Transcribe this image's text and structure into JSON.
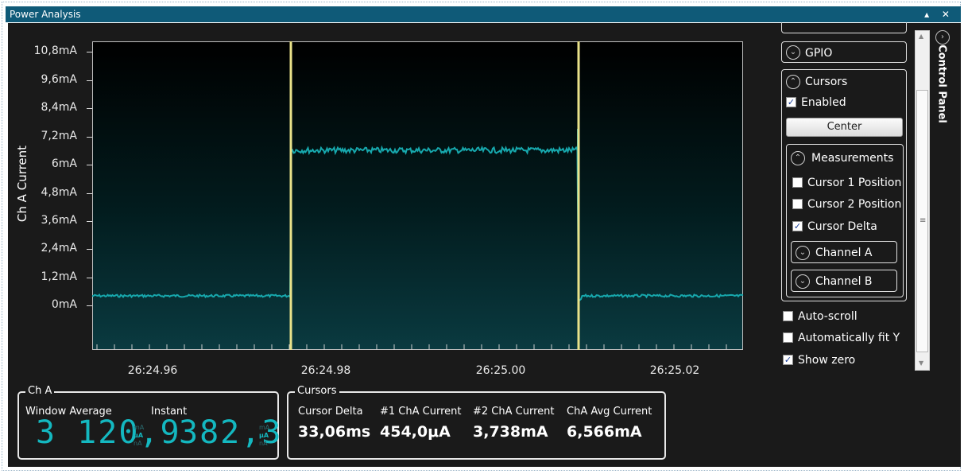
{
  "window": {
    "title": "Power Analysis",
    "controls": "▴ ✕"
  },
  "chart": {
    "y_axis_title": "Ch A Current",
    "y_ticks": [
      "10,8mA",
      "9,6mA",
      "8,4mA",
      "7,2mA",
      "6mA",
      "4,8mA",
      "3,6mA",
      "2,4mA",
      "1,2mA",
      "0mA"
    ],
    "x_ticks": [
      "26:24.96",
      "26:24.98",
      "26:25.00",
      "26:25.02"
    ],
    "trace_color": "#17a8ad",
    "cursor_color": "#e9e28a"
  },
  "chart_data": {
    "type": "line",
    "title": "",
    "xlabel": "",
    "ylabel": "Ch A Current",
    "x_unit": "s (mm:ss.ss)",
    "ylim_mA": [
      -0.6,
      11.6
    ],
    "series": [
      {
        "values_mA": [
          [
            0.0,
            0.45
          ],
          [
            0.3,
            0.45
          ],
          [
            0.301,
            6.5
          ],
          [
            0.75,
            6.6
          ],
          [
            0.751,
            0.2
          ],
          [
            0.76,
            0.45
          ],
          [
            1.0,
            0.45
          ]
        ]
      }
    ],
    "cursors_x": [
      "26:24.976",
      "26:25.009"
    ]
  },
  "ch_a": {
    "legend": "Ch A",
    "window_average_label": "Window Average",
    "window_average_value": "3 120,9",
    "instant_label": "Instant",
    "instant_value": "382,3",
    "units": [
      "mA",
      "μA",
      "nA"
    ]
  },
  "cursors_box": {
    "legend": "Cursors",
    "cols": [
      {
        "label": "Cursor Delta",
        "value": "33,06ms"
      },
      {
        "label": "#1 ChA Current",
        "value": "454,0μA"
      },
      {
        "label": "#2 ChA Current",
        "value": "3,738mA"
      },
      {
        "label": "ChA Avg Current",
        "value": "6,566mA"
      }
    ]
  },
  "control_panel": {
    "title": "Control Panel",
    "gpio_label": "GPIO",
    "cursors_label": "Cursors",
    "enabled_label": "Enabled",
    "center_button": "Center",
    "measurements_label": "Measurements",
    "cursor1_label": "Cursor 1 Position",
    "cursor2_label": "Cursor 2 Position",
    "cursor_delta_label": "Cursor Delta",
    "channel_a_label": "Channel A",
    "channel_b_label": "Channel B",
    "auto_scroll_label": "Auto-scroll",
    "auto_fit_label": "Automatically fit Y",
    "show_zero_label": "Show zero",
    "checks": {
      "enabled": true,
      "cursor1": false,
      "cursor2": false,
      "cursor_delta": true,
      "auto_scroll": false,
      "auto_fit": false,
      "show_zero": true
    }
  }
}
